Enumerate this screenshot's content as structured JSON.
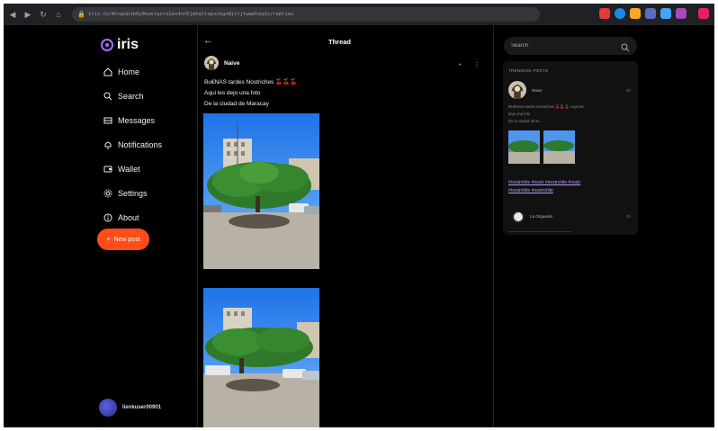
{
  "browser": {
    "url": "iris.to/#/npub1b0y9ozelqcrn2ex4nn5jmhqltnpvskgv8jrrjtwadteq2s/replies",
    "nav_buttons": [
      "back-icon",
      "forward-icon",
      "reload-icon",
      "home-icon"
    ],
    "extension_colors": [
      "#e53935",
      "#1e88e5",
      "#f9a825",
      "#5c6bc0",
      "#42a5f5",
      "#ab47bc",
      "#e91e63"
    ]
  },
  "app": {
    "name": "iris",
    "accent": "#a66bff",
    "cta_color": "#ff4d1a"
  },
  "sidebar": {
    "items": [
      {
        "label": "Home",
        "icon": "home-icon"
      },
      {
        "label": "Search",
        "icon": "search-icon"
      },
      {
        "label": "Messages",
        "icon": "messages-icon"
      },
      {
        "label": "Notifications",
        "icon": "bell-icon"
      },
      {
        "label": "Wallet",
        "icon": "wallet-icon"
      },
      {
        "label": "Settings",
        "icon": "gear-icon"
      },
      {
        "label": "About",
        "icon": "info-icon"
      }
    ],
    "new_post_label": "New post",
    "account_name": "lienkuser00901"
  },
  "thread": {
    "title": "Thread",
    "author": "Naive",
    "lines": [
      "Bu€NAS tardes Nostriches 🍒🍒🍒",
      "Aqui les dejo una foto",
      "De la ciudad de Maracay"
    ]
  },
  "right": {
    "search_placeholder": "Search",
    "panel_title": "TRENDING POSTS",
    "trending": {
      "author": "Naive",
      "time": "4h",
      "line1": "BUENAS tardes Nostriches 🍒🍒🍒 Aqui les",
      "line2": "dejo una foto",
      "line3": "De la ciudad de M...",
      "hashtags_1": "#nostrchile #nostr #nostrchile #nostr",
      "hashtags_2": "#nostrchile #nostrchile"
    },
    "second": {
      "author": "La Orquesta",
      "time": "4h"
    }
  }
}
